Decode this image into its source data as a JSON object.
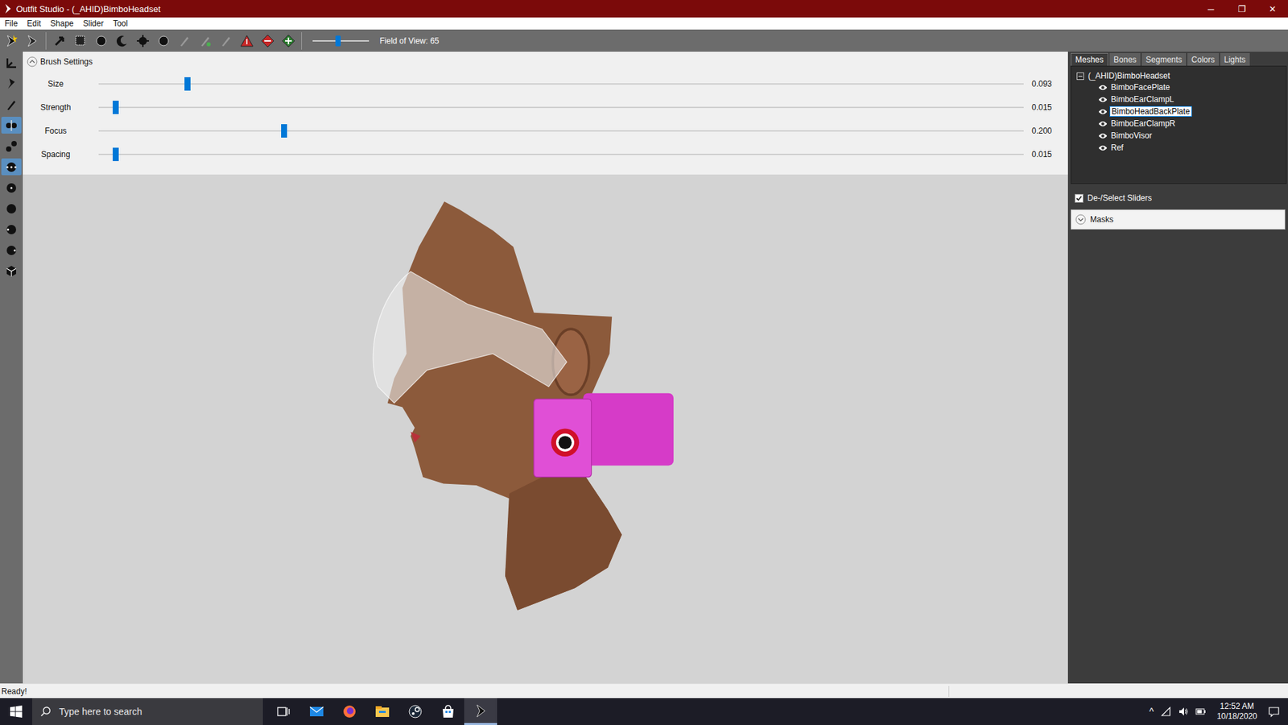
{
  "window": {
    "title": "Outfit Studio - (_AHID)BimboHeadset",
    "controls": [
      "─",
      "❐",
      "✕"
    ]
  },
  "menu": [
    "File",
    "Edit",
    "Shape",
    "Slider",
    "Tool"
  ],
  "toolbar": {
    "fov_label": "Field of View: 65",
    "fov_level": 0.45
  },
  "left_tools": [
    {
      "kind": "axis",
      "selected": false
    },
    {
      "kind": "pin",
      "selected": false
    },
    {
      "kind": "pen",
      "selected": false
    },
    {
      "kind": "split",
      "selected": true
    },
    {
      "kind": "nodes",
      "selected": false
    },
    {
      "kind": "dots",
      "selected": true
    },
    {
      "kind": "dot-small",
      "selected": false
    },
    {
      "kind": "dot-big",
      "selected": false
    },
    {
      "kind": "dot-left",
      "selected": false
    },
    {
      "kind": "dot-right",
      "selected": false
    },
    {
      "kind": "cube",
      "selected": false
    }
  ],
  "brush_settings": {
    "title": "Brush Settings",
    "expanded": true,
    "rows": [
      {
        "label": "Size",
        "level": 0.096,
        "reading": "0.093"
      },
      {
        "label": "Strength",
        "level": 0.018,
        "reading": "0.015"
      },
      {
        "label": "Focus",
        "level": 0.2,
        "reading": "0.200"
      },
      {
        "label": "Spacing",
        "level": 0.018,
        "reading": "0.015"
      }
    ]
  },
  "tabs": [
    {
      "label": "Meshes",
      "selected": true
    },
    {
      "label": "Bones",
      "selected": false
    },
    {
      "label": "Segments",
      "selected": false
    },
    {
      "label": "Colors",
      "selected": false
    },
    {
      "label": "Lights",
      "selected": false
    }
  ],
  "tree": {
    "root": "(_AHID)BimboHeadset",
    "expanded": true,
    "items": [
      {
        "name": "BimboFacePlate",
        "visible": true,
        "selected": false
      },
      {
        "name": "BimboEarClampL",
        "visible": true,
        "selected": false
      },
      {
        "name": "BimboHeadBackPlate",
        "visible": true,
        "selected": true
      },
      {
        "name": "BimboEarClampR",
        "visible": true,
        "selected": false
      },
      {
        "name": "BimboVisor",
        "visible": true,
        "selected": false
      },
      {
        "name": "Ref",
        "visible": true,
        "selected": false
      }
    ]
  },
  "sliders_toggle": {
    "label": "De-/Select Sliders",
    "checked": true
  },
  "masks": {
    "label": "Masks",
    "expanded": false
  },
  "status_bar": {
    "text": "Ready!"
  },
  "taskbar": {
    "search_placeholder": "Type here to search",
    "apps": [
      {
        "kind": "task-view",
        "active": false
      },
      {
        "kind": "mail",
        "active": false
      },
      {
        "kind": "firefox",
        "active": false
      },
      {
        "kind": "explorer",
        "active": false
      },
      {
        "kind": "steam",
        "active": false
      },
      {
        "kind": "store",
        "active": false
      },
      {
        "kind": "outfit-studio",
        "active": true
      }
    ],
    "tray_arrow": "^",
    "time": "12:52 AM",
    "date": "10/18/2020"
  }
}
